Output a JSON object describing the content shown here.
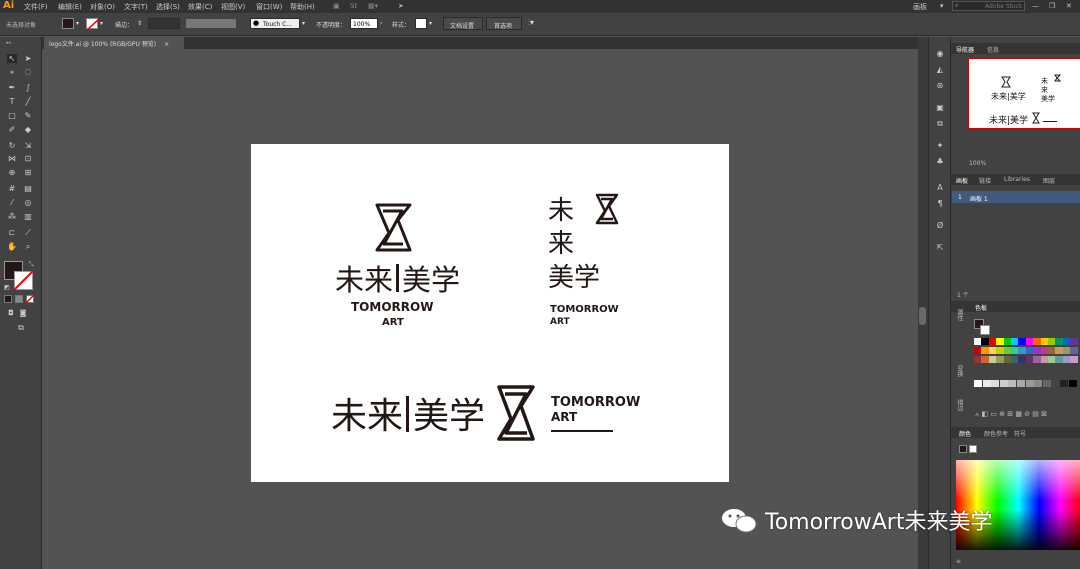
{
  "app_logo": "Ai",
  "menu": [
    "文件(F)",
    "编辑(E)",
    "对象(O)",
    "文字(T)",
    "选择(S)",
    "效果(C)",
    "视图(V)",
    "窗口(W)",
    "帮助(H)"
  ],
  "workspace": "画板",
  "search_placeholder": "Adobe Stock",
  "control": {
    "selection": "未选择对象",
    "stroke_label": "描边：",
    "brush": "Touch C...",
    "opacity_label": "不透明度：",
    "opacity_value": "100%",
    "style_label": "样式：",
    "doc_setup": "文档设置",
    "prefs": "首选项"
  },
  "doc_tab": "logo文件.ai @ 100% (RGB/GPU 预览)",
  "doc_tab_close": "×",
  "logo": {
    "cn1": "未来",
    "cn2": "美学",
    "cn_full": "未来|美学",
    "en1": "TOMORROW",
    "en2": "ART",
    "v_char1": "未",
    "v_char2": "来",
    "v_char3": "美学"
  },
  "panels": {
    "navigator_tab": "导航器",
    "info_tab": "信息",
    "zoom": "100%",
    "artboards_tab": "画板",
    "links_tab": "链接",
    "libraries_tab": "Libraries",
    "layers_tab": "图层",
    "artboard_num": "1",
    "artboard_name": "画板 1",
    "artboard_count": "1 个",
    "swatches_tab": "色板",
    "color_tab": "颜色",
    "color_guide_tab": "颜色参考",
    "symbols_tab": "符号",
    "properties": "属性",
    "transform": "变换",
    "stroke_side": "描边"
  },
  "watermark": "TomorrowArt未来美学",
  "colors": {
    "fill": "#231815",
    "accent": "#ff9a00"
  }
}
